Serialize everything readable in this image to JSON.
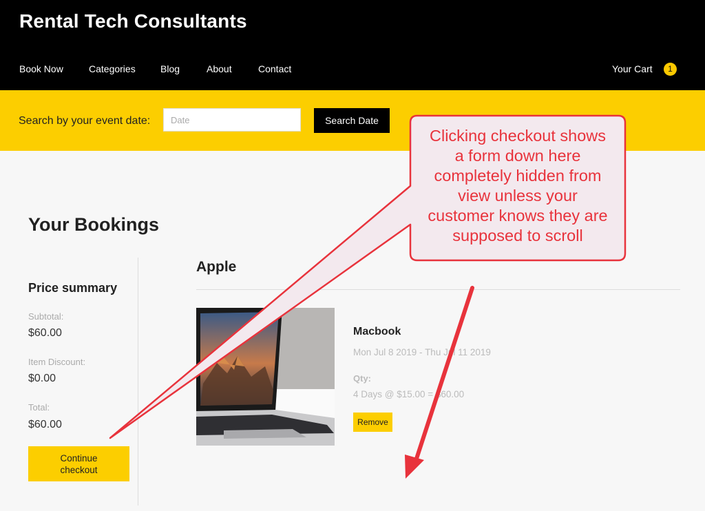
{
  "header": {
    "site_title": "Rental Tech Consultants",
    "nav": [
      "Book Now",
      "Categories",
      "Blog",
      "About",
      "Contact"
    ],
    "cart_label": "Your Cart",
    "cart_count": "1"
  },
  "search": {
    "label": "Search by your event date:",
    "placeholder": "Date",
    "button_label": "Search Date"
  },
  "bookings": {
    "title": "Your Bookings",
    "summary_title": "Price summary",
    "subtotal_label": "Subtotal:",
    "subtotal_value": "$60.00",
    "discount_label": "Item Discount:",
    "discount_value": "$0.00",
    "total_label": "Total:",
    "total_value": "$60.00",
    "checkout_line1": "Continue",
    "checkout_line2": "checkout"
  },
  "cart_group": {
    "brand": "Apple",
    "item": {
      "name": "Macbook",
      "dates": "Mon Jul 8 2019 - Thu Jul 11 2019",
      "qty_label": "Qty:",
      "price_line": "4 Days @ $15.00 = $60.00",
      "remove_label": "Remove"
    }
  },
  "annotation": {
    "text_lines": [
      "Clicking checkout shows",
      "a form down here",
      "completely hidden from",
      "view unless your",
      "customer knows they are",
      "supposed to scroll"
    ],
    "color": "#e8333c"
  },
  "colors": {
    "header_bg": "#000000",
    "accent": "#fcce00",
    "page_bg": "#f7f7f7"
  }
}
